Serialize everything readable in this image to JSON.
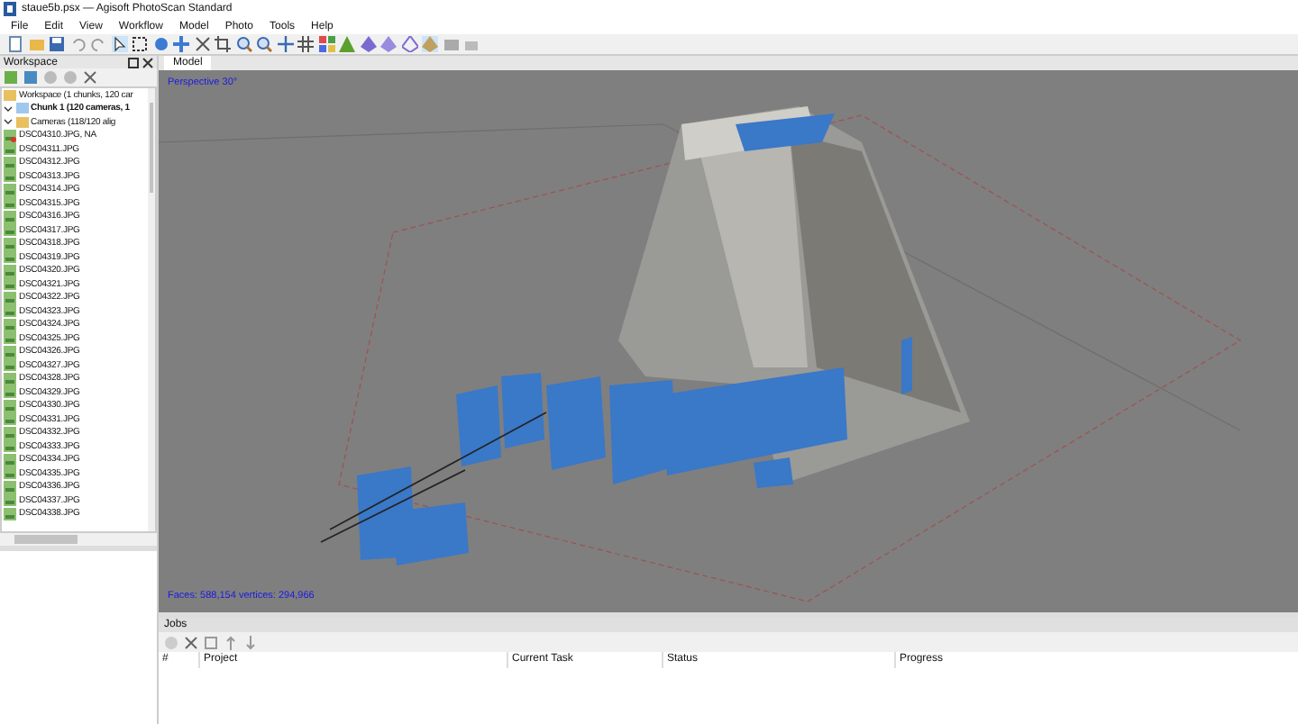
{
  "window": {
    "title": "staue5b.psx — Agisoft PhotoScan Standard"
  },
  "menu": [
    "File",
    "Edit",
    "View",
    "Workflow",
    "Model",
    "Photo",
    "Tools",
    "Help"
  ],
  "workspace_panel": {
    "title": "Workspace",
    "tree": {
      "label": "Workspace (1 chunks, 120 car",
      "children": [
        {
          "label": "Chunk 1 (120 cameras, 1",
          "expanded": true,
          "children": [
            {
              "label": "Cameras (118/120 alig",
              "expanded": true,
              "children": [
                {
                  "label": "DSC04310.JPG, NA",
                  "aligned": false
                },
                {
                  "label": "DSC04311.JPG",
                  "aligned": true
                },
                {
                  "label": "DSC04312.JPG",
                  "aligned": true
                },
                {
                  "label": "DSC04313.JPG",
                  "aligned": true
                },
                {
                  "label": "DSC04314.JPG",
                  "aligned": true
                },
                {
                  "label": "DSC04315.JPG",
                  "aligned": true
                },
                {
                  "label": "DSC04316.JPG",
                  "aligned": true
                },
                {
                  "label": "DSC04317.JPG",
                  "aligned": true
                },
                {
                  "label": "DSC04318.JPG",
                  "aligned": true
                },
                {
                  "label": "DSC04319.JPG",
                  "aligned": true
                },
                {
                  "label": "DSC04320.JPG",
                  "aligned": true
                },
                {
                  "label": "DSC04321.JPG",
                  "aligned": true
                },
                {
                  "label": "DSC04322.JPG",
                  "aligned": true
                },
                {
                  "label": "DSC04323.JPG",
                  "aligned": true
                },
                {
                  "label": "DSC04324.JPG",
                  "aligned": true
                },
                {
                  "label": "DSC04325.JPG",
                  "aligned": true
                },
                {
                  "label": "DSC04326.JPG",
                  "aligned": true
                },
                {
                  "label": "DSC04327.JPG",
                  "aligned": true
                },
                {
                  "label": "DSC04328.JPG",
                  "aligned": true
                },
                {
                  "label": "DSC04329.JPG",
                  "aligned": true
                },
                {
                  "label": "DSC04330.JPG",
                  "aligned": true
                },
                {
                  "label": "DSC04331.JPG",
                  "aligned": true
                },
                {
                  "label": "DSC04332.JPG",
                  "aligned": true
                },
                {
                  "label": "DSC04333.JPG",
                  "aligned": true
                },
                {
                  "label": "DSC04334.JPG",
                  "aligned": true
                },
                {
                  "label": "DSC04335.JPG",
                  "aligned": true
                },
                {
                  "label": "DSC04336.JPG",
                  "aligned": true
                },
                {
                  "label": "DSC04337.JPG",
                  "aligned": true
                },
                {
                  "label": "DSC04338.JPG",
                  "aligned": true
                }
              ]
            }
          ]
        }
      ]
    }
  },
  "model_view": {
    "tab": "Model",
    "projection": "Perspective 30°",
    "stats": "Faces: 588,154 vertices: 294,966"
  },
  "jobs_panel": {
    "title": "Jobs",
    "columns": [
      "#",
      "Project",
      "Current Task",
      "Status",
      "Progress"
    ]
  }
}
